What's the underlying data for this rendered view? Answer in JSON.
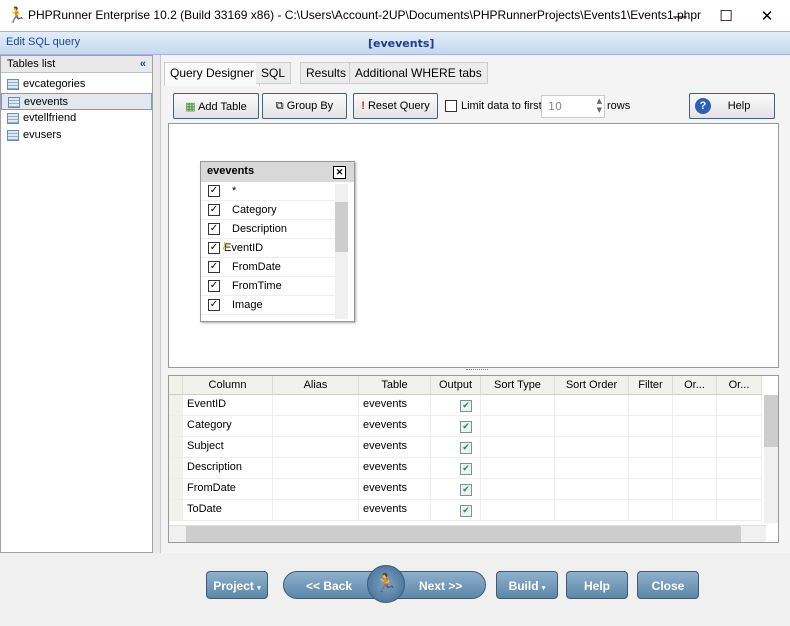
{
  "window": {
    "title": "PHPRunner Enterprise 10.2 (Build 33169 x86) - C:\\Users\\Account-2UP\\Documents\\PHPRunnerProjects\\Events1\\Events1.phpr",
    "minimize": "—",
    "maximize": "☐",
    "close": "✕"
  },
  "header": {
    "left": "Edit SQL query",
    "center": "[evevents]"
  },
  "tables_list": {
    "title": "Tables list",
    "collapse": "«",
    "items": [
      "evcategories",
      "evevents",
      "evtellfriend",
      "evusers"
    ],
    "selected": "evevents"
  },
  "tabs": [
    "Query Designer",
    "SQL",
    "Results",
    "Additional WHERE tabs"
  ],
  "toolbar": {
    "add_table": "Add Table",
    "group_by": "Group By",
    "reset_query": "Reset Query",
    "limit_label": "Limit data to first",
    "limit_checked": false,
    "limit_value": "10",
    "rows": "rows",
    "help": "Help"
  },
  "table_box": {
    "name": "evevents",
    "close": "✕",
    "fields": [
      {
        "name": "*",
        "checked": true
      },
      {
        "name": "Category",
        "checked": true
      },
      {
        "name": "Description",
        "checked": true
      },
      {
        "name": "EventID",
        "checked": true,
        "key": true
      },
      {
        "name": "FromDate",
        "checked": true
      },
      {
        "name": "FromTime",
        "checked": true
      },
      {
        "name": "Image",
        "checked": true
      }
    ]
  },
  "grid": {
    "headers": [
      "Column",
      "Alias",
      "Table",
      "Output",
      "Sort Type",
      "Sort Order",
      "Filter",
      "Or...",
      "Or..."
    ],
    "rows": [
      [
        "EventID",
        "",
        "evevents",
        true
      ],
      [
        "Category",
        "",
        "evevents",
        true
      ],
      [
        "Subject",
        "",
        "evevents",
        true
      ],
      [
        "Description",
        "",
        "evevents",
        true
      ],
      [
        "FromDate",
        "",
        "evevents",
        true
      ],
      [
        "ToDate",
        "",
        "evevents",
        true
      ]
    ]
  },
  "footer": {
    "project": "Project",
    "back": "<< Back",
    "next": "Next >>",
    "build": "Build",
    "help": "Help",
    "close": "Close"
  }
}
